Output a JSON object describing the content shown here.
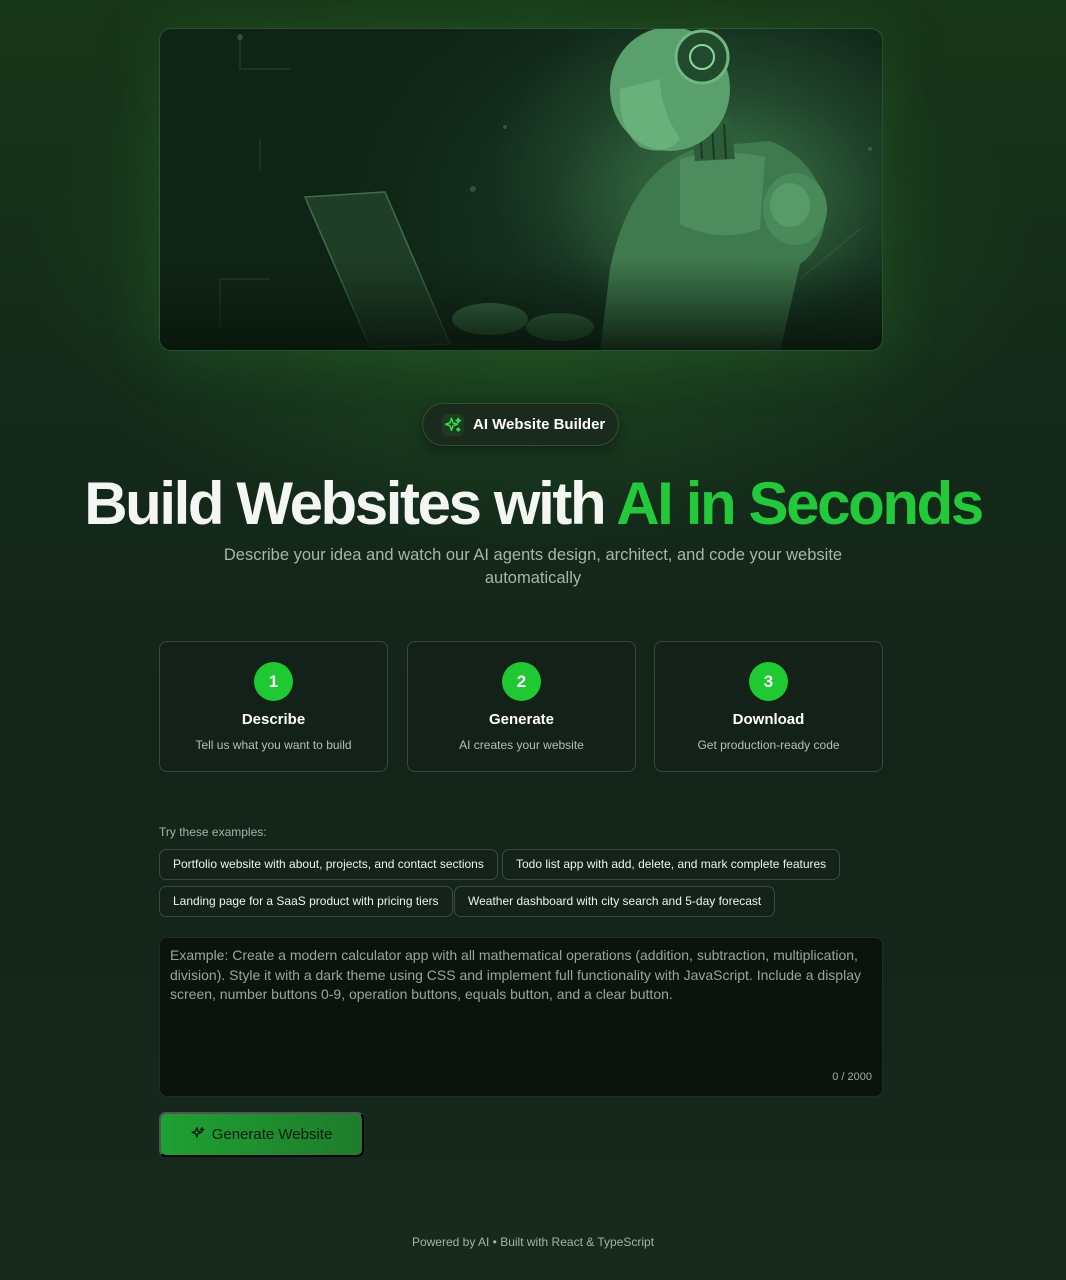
{
  "badge": {
    "icon": "sparkles-icon",
    "label": "AI Website Builder"
  },
  "headline": {
    "part1": "Build Websites with ",
    "part2": "AI in Seconds"
  },
  "subtitle": "Describe your idea and watch our AI agents design, architect, and code your website automatically",
  "steps": [
    {
      "number": "1",
      "title": "Describe",
      "description": "Tell us what you want to build"
    },
    {
      "number": "2",
      "title": "Generate",
      "description": "AI creates your website"
    },
    {
      "number": "3",
      "title": "Download",
      "description": "Get production-ready code"
    }
  ],
  "examples": {
    "label": "Try these examples:",
    "items": [
      "Portfolio website with about, projects, and contact sections",
      "Todo list app with add, delete, and mark complete features",
      "Landing page for a SaaS product with pricing tiers",
      "Weather dashboard with city search and 5-day forecast"
    ]
  },
  "prompt": {
    "value": "",
    "placeholder": "Example: Create a modern calculator app with all mathematical operations (addition, subtraction, multiplication, division). Style it with a dark theme using CSS and implement full functionality with JavaScript. Include a display screen, number buttons 0-9, operation buttons, equals button, and a clear button.",
    "counter": "0 / 2000"
  },
  "generate_button": {
    "icon": "sparkles-icon",
    "label": "Generate Website"
  },
  "footer": "Powered by AI • Built with React & TypeScript",
  "colors": {
    "accent": "#22c93a",
    "background": "#132419"
  }
}
